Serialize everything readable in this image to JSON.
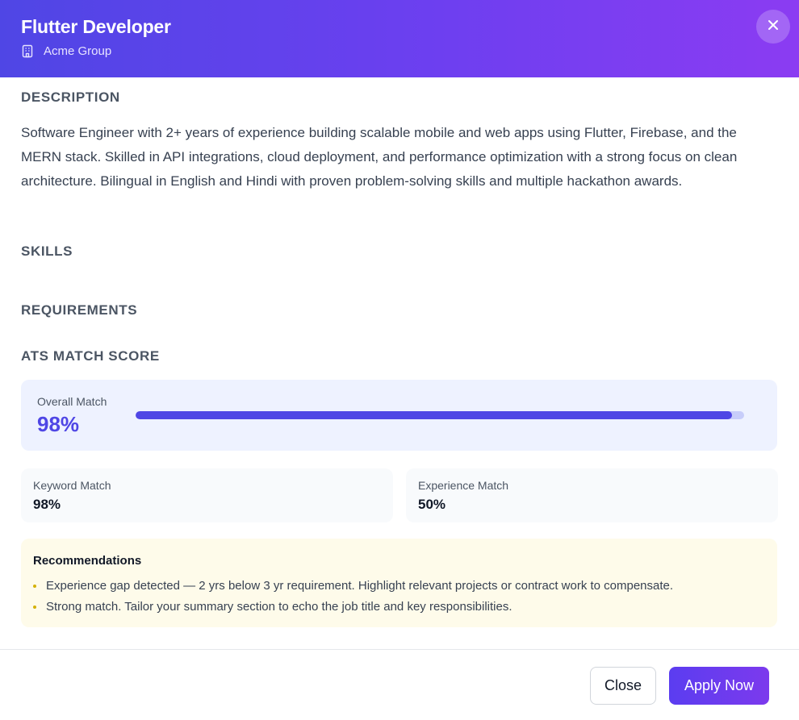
{
  "header": {
    "title": "Flutter Developer",
    "company": "Acme Group",
    "icons": {
      "company": "building-icon",
      "close": "close-icon"
    }
  },
  "sections": {
    "description_heading": "DESCRIPTION",
    "description_text": "Software Engineer with 2+ years of experience building scalable mobile and web apps using Flutter, Firebase, and the MERN stack. Skilled in API integrations, cloud deployment, and performance optimization with a strong focus on clean architecture. Bilingual in English and Hindi with proven problem-solving skills and multiple hackathon awards.",
    "skills_heading": "SKILLS",
    "requirements_heading": "REQUIREMENTS",
    "ats_heading": "ATS MATCH SCORE"
  },
  "ats": {
    "overall_label": "Overall Match",
    "overall_value": "98%",
    "overall_fraction": 0.98,
    "keyword_label": "Keyword Match",
    "keyword_value": "98%",
    "experience_label": "Experience Match",
    "experience_value": "50%"
  },
  "recommendations": {
    "title": "Recommendations",
    "items": [
      "Experience gap detected — 2 yrs below 3 yr requirement. Highlight relevant projects or contract work to compensate.",
      "Strong match. Tailor your summary section to echo the job title and key responsibilities."
    ]
  },
  "footer": {
    "close_label": "Close",
    "apply_label": "Apply Now"
  },
  "colors": {
    "accent": "#4f46e5",
    "header_gradient_end": "#8b3cf2",
    "recommendation_bg": "#fefbea"
  }
}
